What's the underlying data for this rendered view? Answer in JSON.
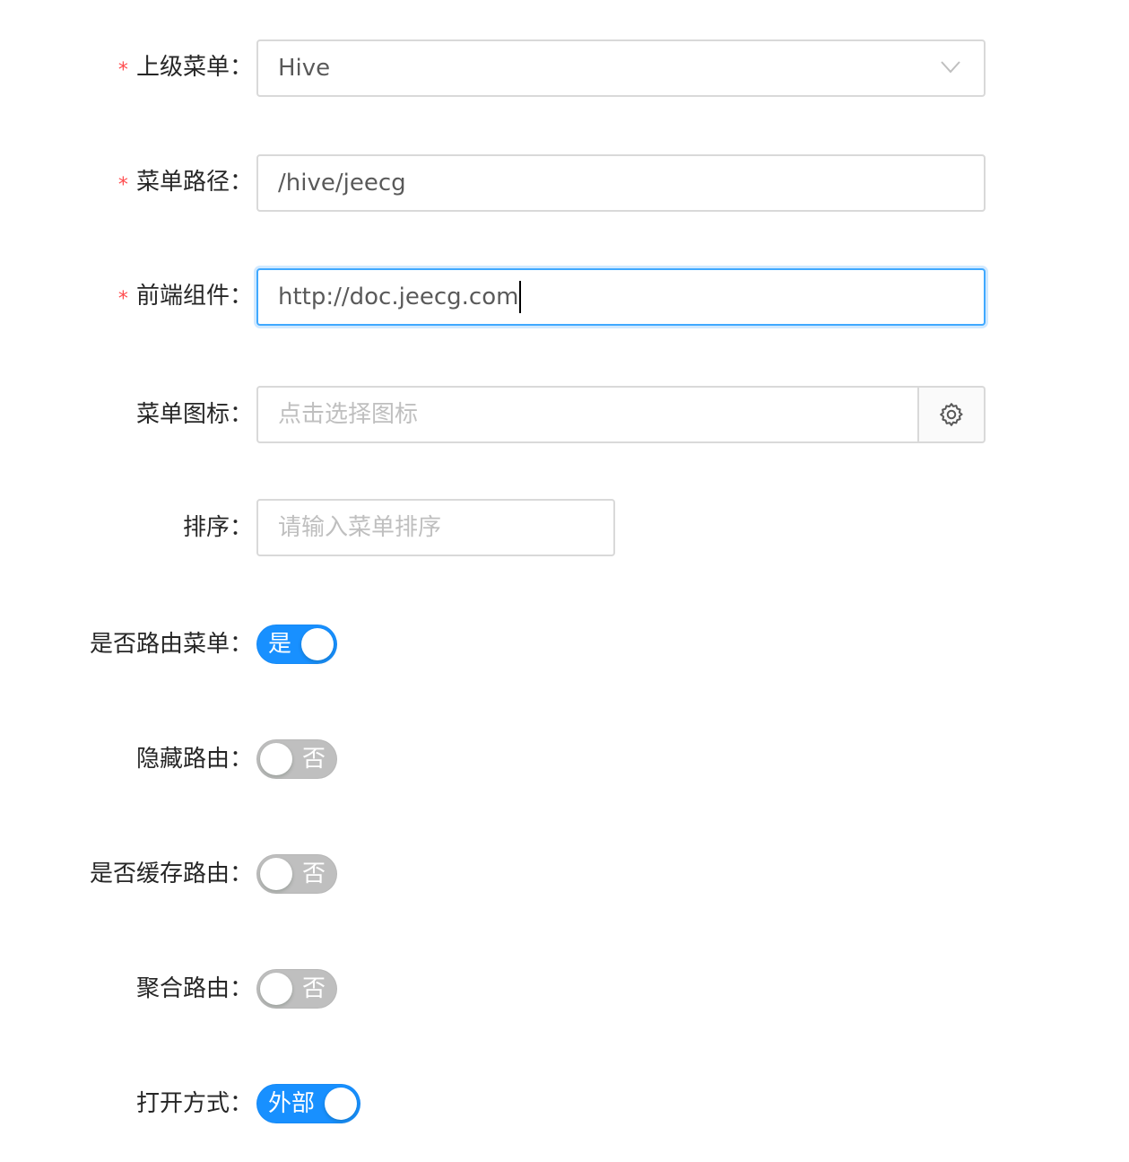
{
  "form": {
    "parent_menu": {
      "label": "上级菜单",
      "required": true,
      "value": "Hive"
    },
    "menu_path": {
      "label": "菜单路径",
      "required": true,
      "value": "/hive/jeecg"
    },
    "frontend_component": {
      "label": "前端组件",
      "required": true,
      "value": "http://doc.jeecg.com"
    },
    "menu_icon": {
      "label": "菜单图标",
      "placeholder": "点击选择图标",
      "addon_icon": "gear-icon"
    },
    "sort": {
      "label": "排序",
      "placeholder": "请输入菜单排序"
    },
    "is_route_menu": {
      "label": "是否路由菜单",
      "checked": true,
      "text": "是"
    },
    "hide_route": {
      "label": "隐藏路由",
      "checked": false,
      "text": "否"
    },
    "cache_route": {
      "label": "是否缓存路由",
      "checked": false,
      "text": "否"
    },
    "aggregate_route": {
      "label": "聚合路由",
      "checked": false,
      "text": "否"
    },
    "open_mode": {
      "label": "打开方式",
      "checked": true,
      "text": "外部"
    }
  },
  "colon": "：",
  "required_mark": "*",
  "colors": {
    "primary": "#1890ff",
    "focus_border": "#40a9ff",
    "required": "#ff4d4f",
    "switch_off": "#bfbfbf",
    "border": "#d9d9d9",
    "placeholder": "#bfbfbf"
  }
}
